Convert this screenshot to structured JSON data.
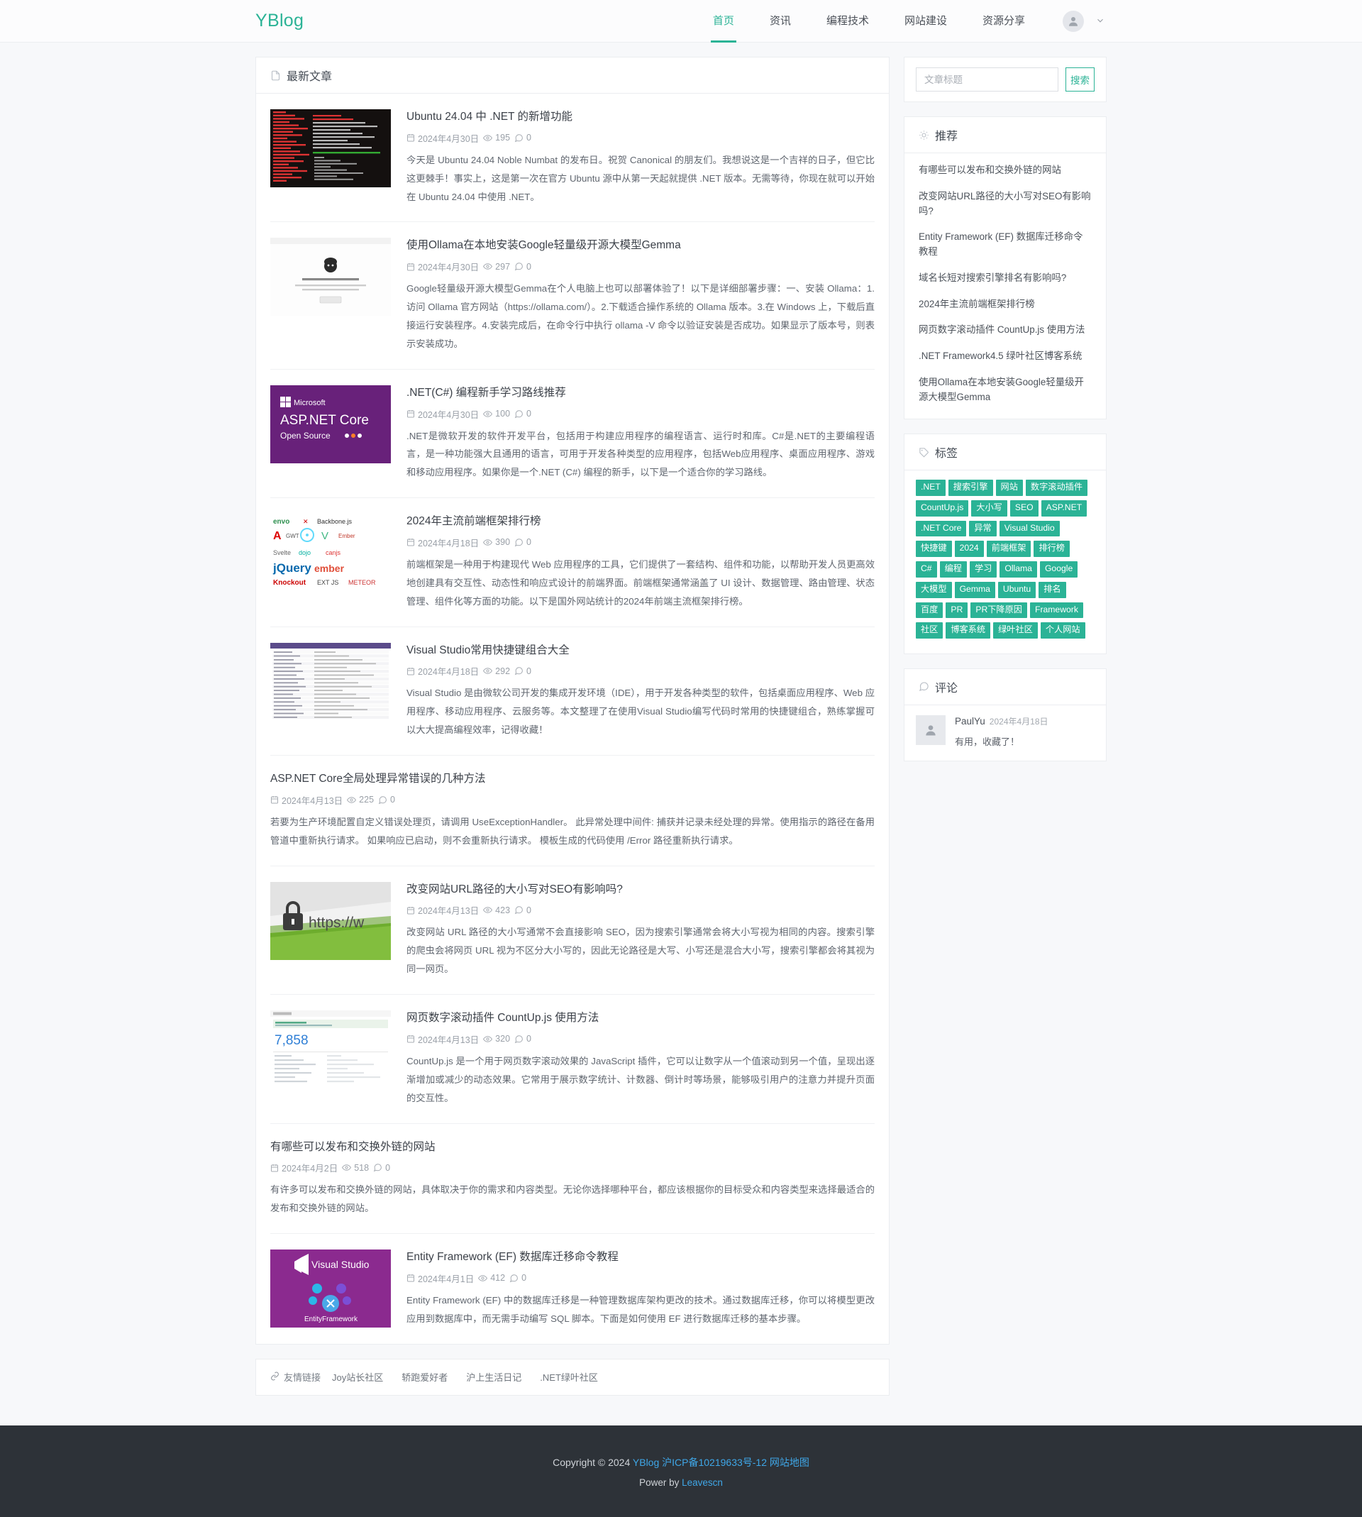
{
  "navbar": {
    "brand": "YBlog",
    "links": [
      {
        "label": "首页",
        "active": true
      },
      {
        "label": "资讯",
        "active": false
      },
      {
        "label": "编程技术",
        "active": false
      },
      {
        "label": "网站建设",
        "active": false
      },
      {
        "label": "资源分享",
        "active": false
      }
    ],
    "avatar_icon": "user-avatar-icon",
    "caret_icon": "chevron-down-icon"
  },
  "main": {
    "section_title": "最新文章",
    "section_icon": "document-icon",
    "articles": [
      {
        "title": "Ubuntu 24.04 中 .NET 的新增功能",
        "date": "2024年4月30日",
        "views": "195",
        "comments": "0",
        "desc": "今天是 Ubuntu 24.04 Noble Numbat 的发布日。祝贺 Canonical 的朋友们。我想说这是一个吉祥的日子，但它比这更棘手！事实上，这是第一次在官方 Ubuntu 源中从第一天起就提供 .NET 版本。无需等待，你现在就可以开始在 Ubuntu 24.04 中使用 .NET。",
        "thumb": "terminal-neofetch"
      },
      {
        "title": "使用Ollama在本地安装Google轻量级开源大模型Gemma",
        "date": "2024年4月30日",
        "views": "297",
        "comments": "0",
        "desc": "Google轻量级开源大模型Gemma在个人电脑上也可以部署体验了！以下是详细部署步骤：一、安装 Ollama：1.访问 Ollama 官方网站（https://ollama.com/）。2.下载适合操作系统的 Ollama 版本。3.在 Windows 上，下载后直接运行安装程序。4.安装完成后，在命令行中执行 ollama -V 命令以验证安装是否成功。如果显示了版本号，则表示安装成功。",
        "thumb": "ollama-page"
      },
      {
        "title": ".NET(C#) 编程新手学习路线推荐",
        "date": "2024年4月30日",
        "views": "100",
        "comments": "0",
        "desc": ".NET是微软开发的软件开发平台，包括用于构建应用程序的编程语言、运行时和库。C#是.NET的主要编程语言，是一种功能强大且通用的语言，可用于开发各种类型的应用程序，包括Web应用程序、桌面应用程序、游戏和移动应用程序。如果你是一个.NET (C#) 编程的新手，以下是一个适合你的学习路线。",
        "thumb": "aspnet-core"
      },
      {
        "title": "2024年主流前端框架排行榜",
        "date": "2024年4月18日",
        "views": "390",
        "comments": "0",
        "desc": "前端框架是一种用于构建现代 Web 应用程序的工具，它们提供了一套结构、组件和功能，以帮助开发人员更高效地创建具有交互性、动态性和响应式设计的前端界面。前端框架通常涵盖了 UI 设计、数据管理、路由管理、状态管理、组件化等方面的功能。以下是国外网站统计的2024年前端主流框架排行榜。",
        "thumb": "framework-logos"
      },
      {
        "title": "Visual Studio常用快捷键组合大全",
        "date": "2024年4月18日",
        "views": "292",
        "comments": "0",
        "desc": "Visual Studio 是由微软公司开发的集成开发环境（IDE），用于开发各种类型的软件，包括桌面应用程序、Web 应用程序、移动应用程序、云服务等。本文整理了在使用Visual Studio编写代码时常用的快捷键组合，熟练掌握可以大大提高编程效率，记得收藏！",
        "thumb": "shortcut-table"
      },
      {
        "title": "ASP.NET Core全局处理异常错误的几种方法",
        "date": "2024年4月13日",
        "views": "225",
        "comments": "0",
        "desc": "若要为生产环境配置自定义错误处理页，请调用 UseExceptionHandler。 此异常处理中间件: 捕获并记录未经处理的异常。使用指示的路径在备用管道中重新执行请求。 如果响应已启动，则不会重新执行请求。 模板生成的代码使用 /Error 路径重新执行请求。",
        "thumb": "none"
      },
      {
        "title": "改变网站URL路径的大小写对SEO有影响吗?",
        "date": "2024年4月13日",
        "views": "423",
        "comments": "0",
        "desc": "改变网站 URL 路径的大小写通常不会直接影响 SEO，因为搜索引擎通常会将大小写视为相同的内容。搜索引擎的爬虫会将网页 URL 视为不区分大小写的，因此无论路径是大写、小写还是混合大小写，搜索引擎都会将其视为同一网页。",
        "thumb": "https-lock"
      },
      {
        "title": "网页数字滚动插件 CountUp.js 使用方法",
        "date": "2024年4月13日",
        "views": "320",
        "comments": "0",
        "desc": "CountUp.js 是一个用于网页数字滚动效果的 JavaScript 插件，它可以让数字从一个值滚动到另一个值，呈现出逐渐增加或减少的动态效果。它常用于展示数字统计、计数器、倒计时等场景，能够吸引用户的注意力并提升页面的交互性。",
        "thumb": "countup-demo"
      },
      {
        "title": "有哪些可以发布和交换外链的网站",
        "date": "2024年4月2日",
        "views": "518",
        "comments": "0",
        "desc": "有许多可以发布和交换外链的网站，具体取决于你的需求和内容类型。无论你选择哪种平台，都应该根据你的目标受众和内容类型来选择最适合的发布和交换外链的网站。",
        "thumb": "none"
      },
      {
        "title": "Entity Framework (EF) 数据库迁移命令教程",
        "date": "2024年4月1日",
        "views": "412",
        "comments": "0",
        "desc": "Entity Framework (EF) 中的数据库迁移是一种管理数据库架构更改的技术。通过数据库迁移，你可以将模型更改应用到数据库中，而无需手动编写 SQL 脚本。下面是如何使用 EF 进行数据库迁移的基本步骤。",
        "thumb": "ef-visualstudio"
      }
    ]
  },
  "sidebar": {
    "search": {
      "placeholder": "文章标题",
      "value": "",
      "button": "搜索"
    },
    "recommend": {
      "title": "推荐",
      "icon": "sun-icon",
      "items": [
        "有哪些可以发布和交换外链的网站",
        "改变网站URL路径的大小写对SEO有影响吗?",
        "Entity Framework (EF) 数据库迁移命令教程",
        "域名长短对搜索引擎排名有影响吗?",
        "2024年主流前端框架排行榜",
        "网页数字滚动插件 CountUp.js 使用方法",
        ".NET Framework4.5 绿叶社区博客系统",
        "使用Ollama在本地安装Google轻量级开源大模型Gemma"
      ]
    },
    "tags": {
      "title": "标签",
      "icon": "tag-icon",
      "items": [
        ".NET",
        "搜索引擎",
        "网站",
        "数字滚动插件",
        "CountUp.js",
        "大小写",
        "SEO",
        "ASP.NET",
        ".NET Core",
        "异常",
        "Visual Studio",
        "快捷键",
        "2024",
        "前端框架",
        "排行榜",
        "C#",
        "编程",
        "学习",
        "Ollama",
        "Google",
        "大模型",
        "Gemma",
        "Ubuntu",
        "排名",
        "百度",
        "PR",
        "PR下降原因",
        "Framework",
        "社区",
        "博客系统",
        "绿叶社区",
        "个人网站"
      ]
    },
    "comments": {
      "title": "评论",
      "icon": "comment-icon",
      "items": [
        {
          "author": "PaulYu",
          "date": "2024年4月18日",
          "text": "有用，收藏了！"
        }
      ]
    }
  },
  "friend_links": {
    "label": "友情链接",
    "icon": "link-icon",
    "items": [
      "Joy站长社区",
      "轿跑爱好者",
      "沪上生活日记",
      ".NET绿叶社区"
    ]
  },
  "footer": {
    "copyright_prefix": "Copyright © 2024",
    "brand": "YBlog",
    "icp": "沪ICP备10219633号-12",
    "sitemap": "网站地图",
    "power_prefix": "Power by",
    "power_by": "Leavescn"
  },
  "colors": {
    "accent": "#2bb396",
    "footer_bg": "#2d3238",
    "footer_link": "#3fa7e8"
  }
}
